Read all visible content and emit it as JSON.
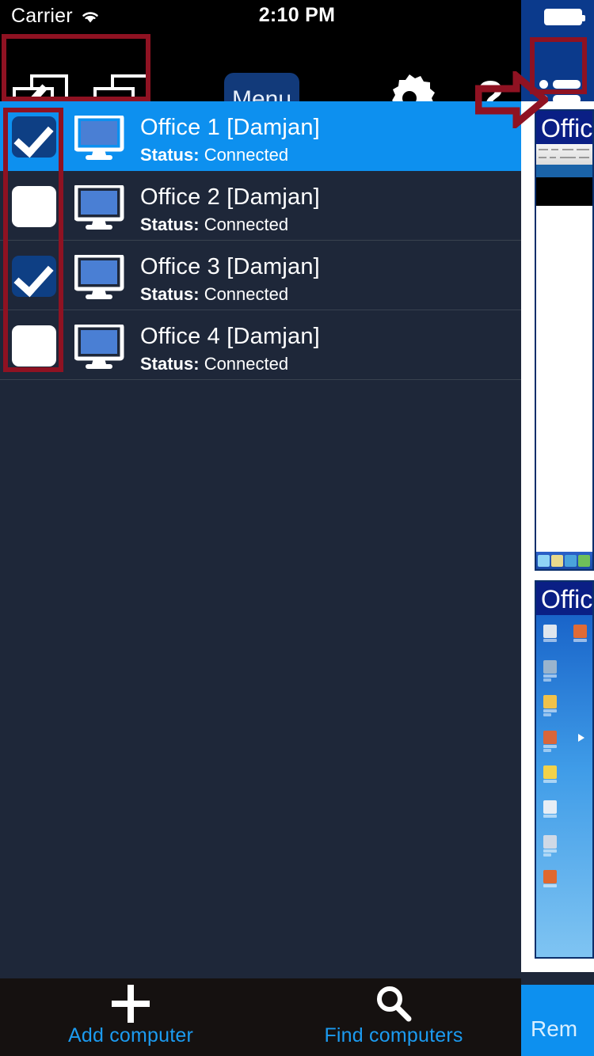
{
  "status_bar": {
    "carrier": "Carrier",
    "wifi_icon": "wifi-icon",
    "time": "2:10 PM",
    "battery_icon": "battery-full-icon"
  },
  "toolbar": {
    "select_all_icon": "select-all-icon",
    "deselect_all_icon": "deselect-all-icon",
    "menu_label": "Menu",
    "settings_icon": "gear-icon",
    "help_label": "?",
    "arrow_icon": "red-arrow-icon",
    "list_view_icon": "list-view-icon",
    "highlight_color": "#8f1222",
    "menu_button_color": "#123a7a"
  },
  "computers": [
    {
      "name": "Office 1 [Damjan]",
      "status_label": "Status:",
      "status_value": "Connected",
      "checked": true,
      "selected": true
    },
    {
      "name": "Office 2 [Damjan]",
      "status_label": "Status:",
      "status_value": "Connected",
      "checked": false,
      "selected": false
    },
    {
      "name": "Office 3 [Damjan]",
      "status_label": "Status:",
      "status_value": "Connected",
      "checked": true,
      "selected": false
    },
    {
      "name": "Office 4 [Damjan]",
      "status_label": "Status:",
      "status_value": "Connected",
      "checked": false,
      "selected": false
    }
  ],
  "thumbnails": [
    {
      "title": "Office",
      "kind": "remote-desktop-window"
    },
    {
      "title": "Office",
      "kind": "remote-desktop-window"
    }
  ],
  "bottom_bar": {
    "add_label": "Add computer",
    "add_icon": "plus-icon",
    "find_label": "Find computers",
    "find_icon": "search-icon",
    "remove_label": "Rem",
    "accent_color": "#1c9bf0",
    "remove_button_color": "#0d90ef"
  },
  "theme": {
    "list_background": "#1e2739",
    "selected_row": "#0d90ef",
    "bar_background": "#000000",
    "bottom_background": "#151110"
  }
}
